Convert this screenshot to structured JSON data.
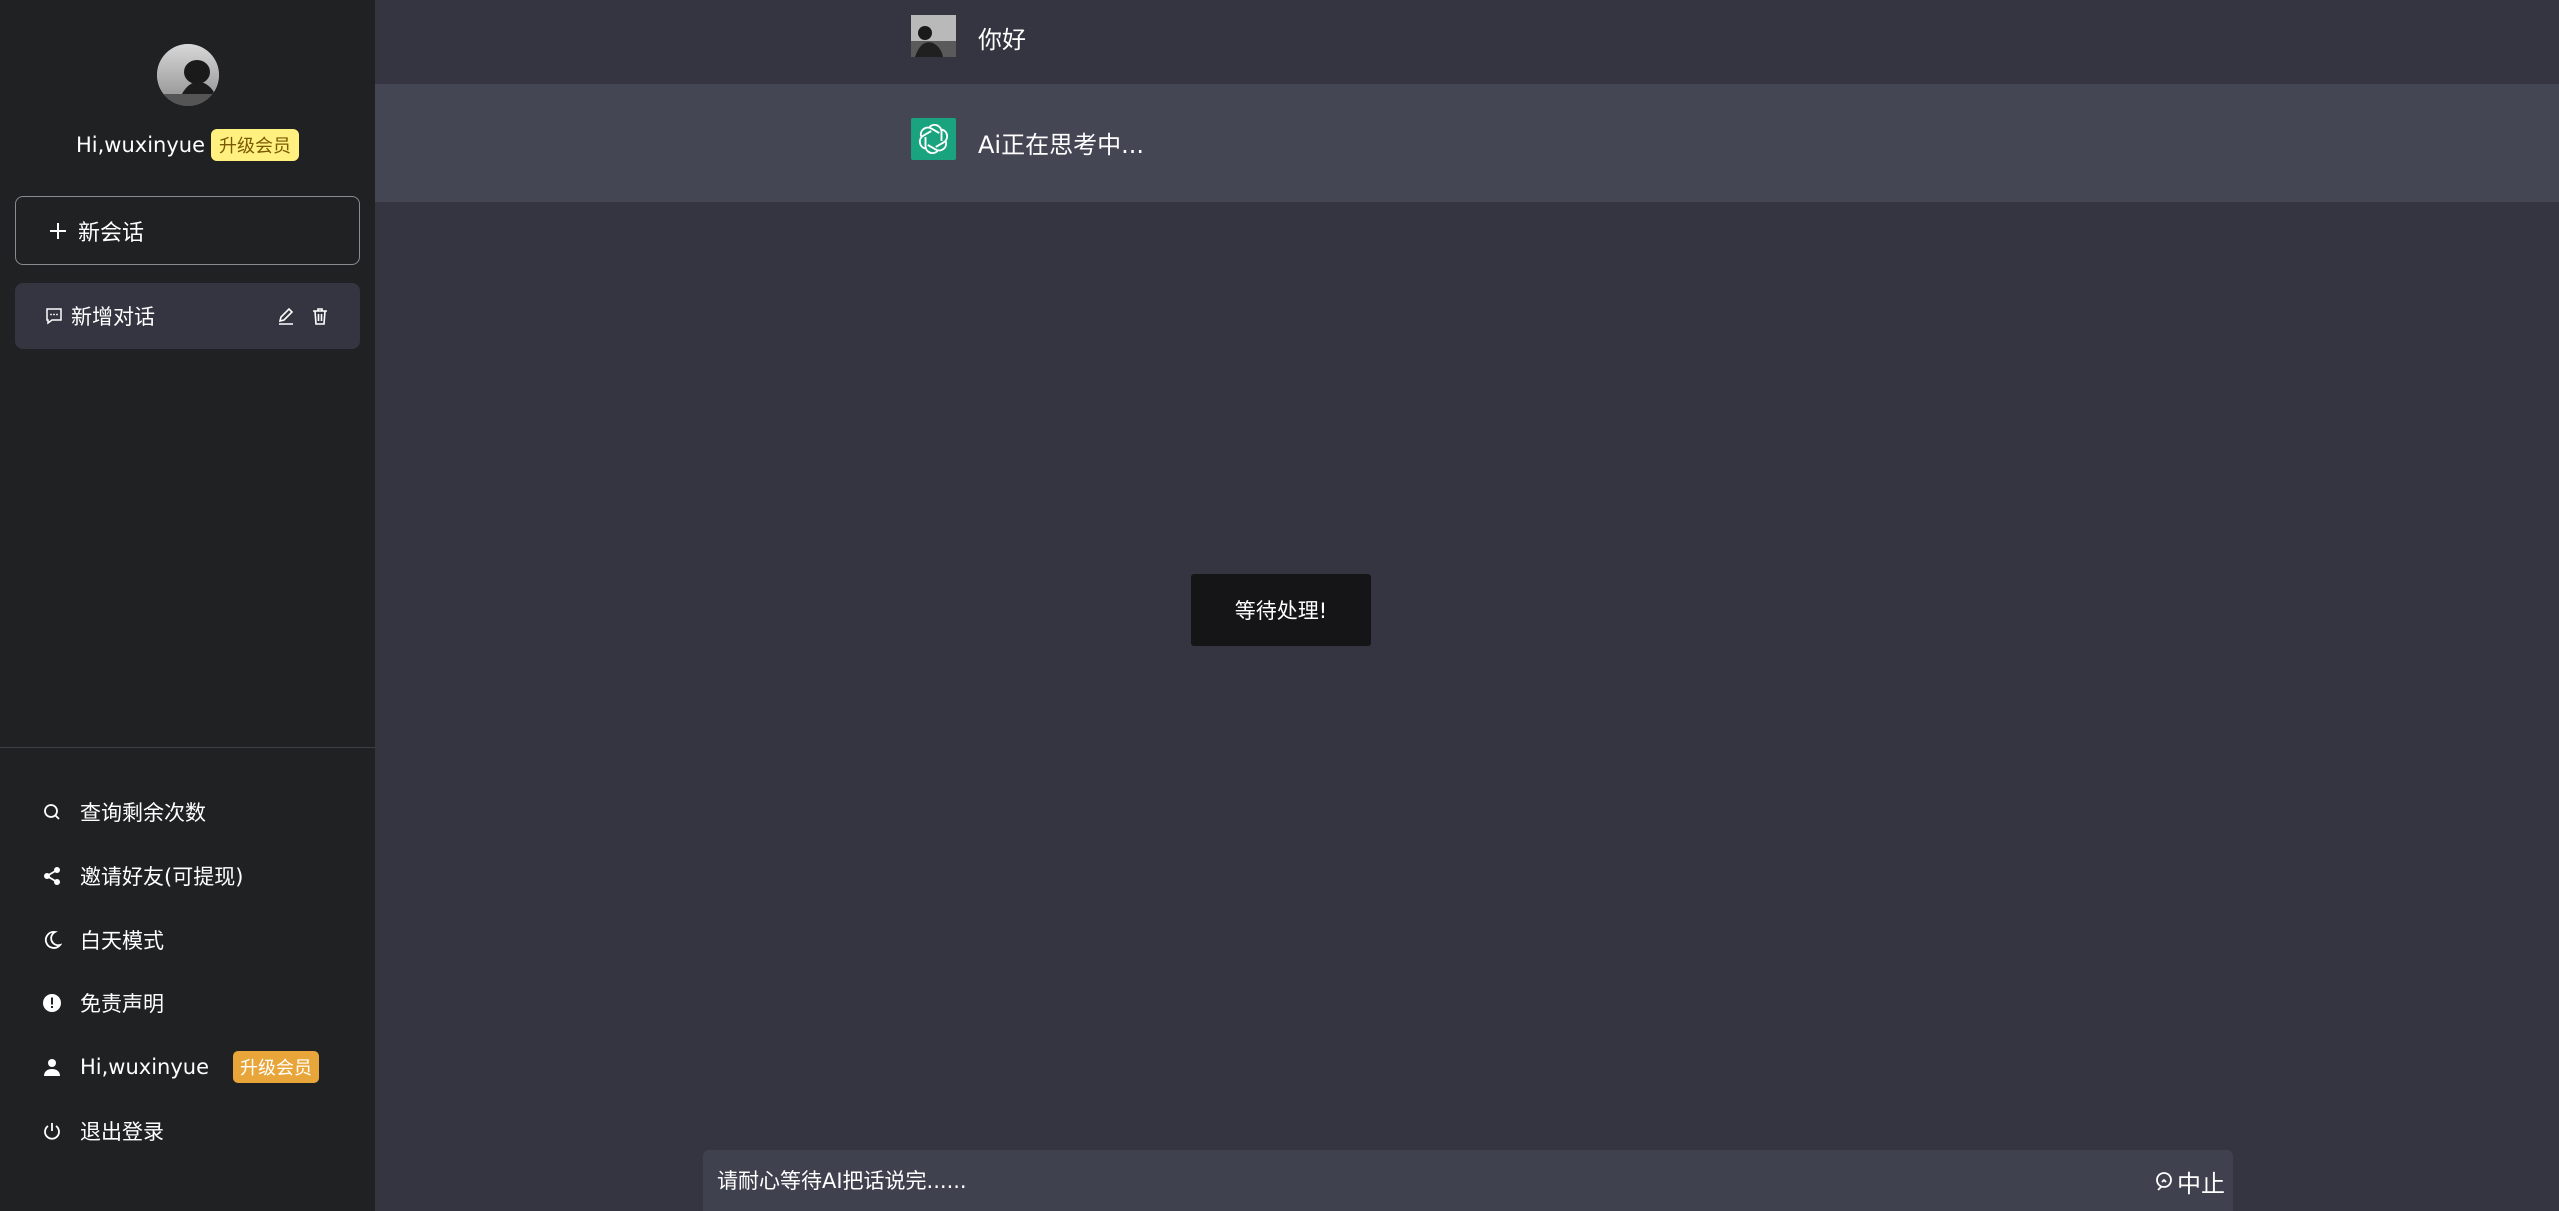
{
  "sidebar": {
    "greeting": "Hi,wuxinyue",
    "member_badge": "升级会员",
    "new_chat_label": "新会话",
    "conversation": {
      "title": "新增对话"
    },
    "menu": [
      {
        "label": "查询剩余次数",
        "icon": "search-icon"
      },
      {
        "label": "邀请好友(可提现)",
        "icon": "share-icon"
      },
      {
        "label": "白天模式",
        "icon": "moon-icon"
      },
      {
        "label": "免责声明",
        "icon": "alert-icon"
      },
      {
        "label": "Hi,wuxinyue",
        "icon": "user-icon",
        "badge": "升级会员"
      },
      {
        "label": "退出登录",
        "icon": "power-icon"
      }
    ]
  },
  "chat": {
    "user_message": "你好",
    "ai_message": "Ai正在思考中..."
  },
  "toast": {
    "text": "等待处理!"
  },
  "input": {
    "placeholder": "请耐心等待AI把话说完......",
    "stop_label": "中止"
  },
  "colors": {
    "sidebar_bg": "#202123",
    "main_bg": "#343541",
    "ai_row_bg": "#444654",
    "openai_green": "#19a37f",
    "badge_yellow": "#fff080",
    "badge_orange": "#e8a63a"
  }
}
